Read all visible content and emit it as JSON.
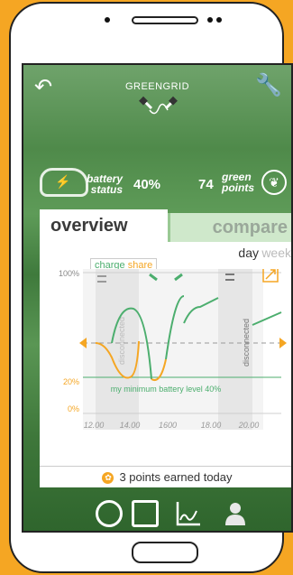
{
  "app": {
    "title": "GREENGRID"
  },
  "status": {
    "battery_label_1": "battery",
    "battery_label_2": "status",
    "battery_value": "40%",
    "green_value": "74",
    "green_label_1": "green",
    "green_label_2": "points"
  },
  "tabs": [
    {
      "label": "overview",
      "active": true
    },
    {
      "label": "compare",
      "active": false
    }
  ],
  "range": {
    "day": "day",
    "week": "week",
    "selected": "day"
  },
  "legend": {
    "charge": "charge",
    "share": "share"
  },
  "chart_data": {
    "type": "line",
    "y_ticks": [
      "100%",
      "20%",
      "0%"
    ],
    "x_ticks": [
      "12.00",
      "14.00",
      "1600",
      "18.00",
      "20.00"
    ],
    "min_line_label": "my minimum battery level 40%",
    "disconnected_label": "disconnected",
    "series": [
      {
        "name": "charge",
        "color": "#4cae6e"
      },
      {
        "name": "share",
        "color": "#f5a623"
      }
    ]
  },
  "earned": {
    "text": "3 points earned today"
  },
  "colors": {
    "accent": "#4cae6e",
    "share": "#f5a623",
    "frame": "#f5a623"
  },
  "nav": [
    {
      "icon": "clock-plug-icon"
    },
    {
      "icon": "calendar-icon"
    },
    {
      "icon": "chart-icon",
      "active": true
    },
    {
      "icon": "user-icon"
    }
  ]
}
